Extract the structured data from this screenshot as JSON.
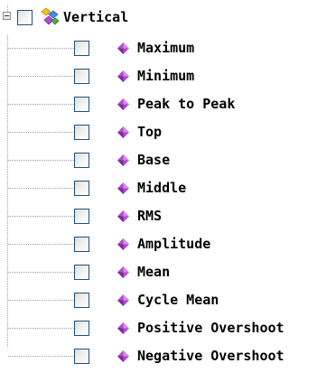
{
  "tree": {
    "root": {
      "label": "Vertical",
      "expanded": true,
      "checked": false,
      "icon": "multi-gem-folder-icon"
    },
    "children": [
      {
        "label": "Maximum",
        "checked": false,
        "icon": "purple-gem-icon"
      },
      {
        "label": "Minimum",
        "checked": false,
        "icon": "purple-gem-icon"
      },
      {
        "label": "Peak to Peak",
        "checked": false,
        "icon": "purple-gem-icon"
      },
      {
        "label": "Top",
        "checked": false,
        "icon": "purple-gem-icon"
      },
      {
        "label": "Base",
        "checked": false,
        "icon": "purple-gem-icon"
      },
      {
        "label": "Middle",
        "checked": false,
        "icon": "purple-gem-icon"
      },
      {
        "label": "RMS",
        "checked": false,
        "icon": "purple-gem-icon"
      },
      {
        "label": "Amplitude",
        "checked": false,
        "icon": "purple-gem-icon"
      },
      {
        "label": "Mean",
        "checked": false,
        "icon": "purple-gem-icon"
      },
      {
        "label": "Cycle Mean",
        "checked": false,
        "icon": "purple-gem-icon"
      },
      {
        "label": "Positive Overshoot",
        "checked": false,
        "icon": "purple-gem-icon"
      },
      {
        "label": "Negative Overshoot",
        "checked": false,
        "icon": "purple-gem-icon"
      }
    ]
  },
  "colors": {
    "gem": "#b04ad0",
    "checkbox_border": "#1c5180",
    "connector": "#a0a0a0",
    "text": "#000000"
  }
}
